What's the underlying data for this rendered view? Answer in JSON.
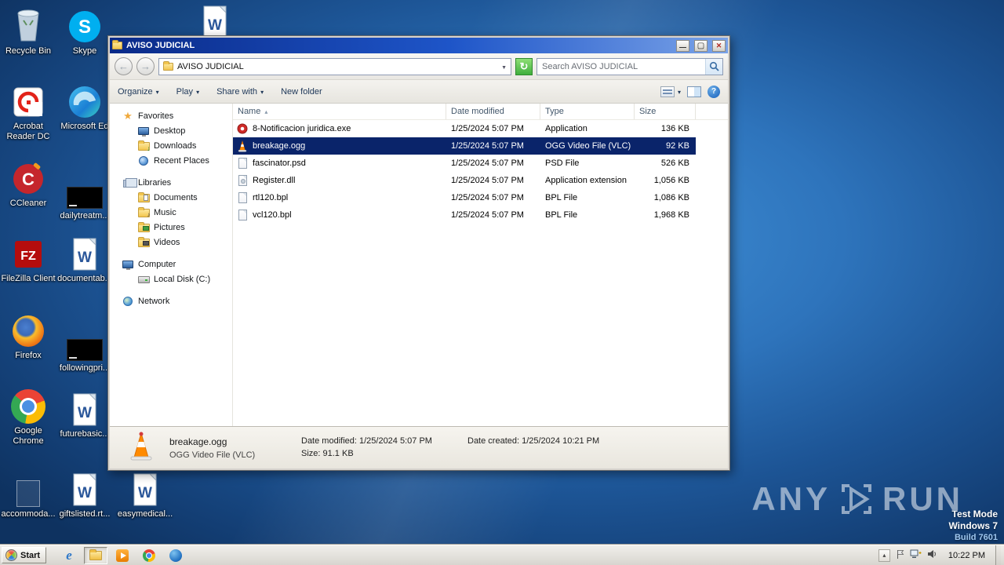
{
  "desktop": {
    "icons": [
      {
        "label": "Recycle Bin"
      },
      {
        "label": "Acrobat Reader DC"
      },
      {
        "label": "CCleaner"
      },
      {
        "label": "FileZilla Client"
      },
      {
        "label": "Firefox"
      },
      {
        "label": "Google Chrome"
      },
      {
        "label": "accommoda..."
      },
      {
        "label": "Skype"
      },
      {
        "label": "Microsoft Ed"
      },
      {
        "label": "dailytreatm..."
      },
      {
        "label": "documentab..."
      },
      {
        "label": "followingpri..."
      },
      {
        "label": "futurebasic..."
      },
      {
        "label": "giftslisted.rt..."
      },
      {
        "label": "easymedical..."
      }
    ]
  },
  "window": {
    "title": "AVISO JUDICIAL",
    "address": "AVISO JUDICIAL",
    "search_placeholder": "Search AVISO JUDICIAL",
    "toolbar": {
      "organize": "Organize",
      "play": "Play",
      "share_with": "Share with",
      "new_folder": "New folder"
    },
    "columns": {
      "name": "Name",
      "date_modified": "Date modified",
      "type": "Type",
      "size": "Size"
    },
    "files": [
      {
        "name": "8-Notificacion juridica.exe",
        "date": "1/25/2024 5:07 PM",
        "type": "Application",
        "size": "136 KB"
      },
      {
        "name": "breakage.ogg",
        "date": "1/25/2024 5:07 PM",
        "type": "OGG Video File (VLC)",
        "size": "92 KB"
      },
      {
        "name": "fascinator.psd",
        "date": "1/25/2024 5:07 PM",
        "type": "PSD File",
        "size": "526 KB"
      },
      {
        "name": "Register.dll",
        "date": "1/25/2024 5:07 PM",
        "type": "Application extension",
        "size": "1,056 KB"
      },
      {
        "name": "rtl120.bpl",
        "date": "1/25/2024 5:07 PM",
        "type": "BPL File",
        "size": "1,086 KB"
      },
      {
        "name": "vcl120.bpl",
        "date": "1/25/2024 5:07 PM",
        "type": "BPL File",
        "size": "1,968 KB"
      }
    ],
    "sidebar": {
      "favorites": {
        "label": "Favorites",
        "items": [
          "Desktop",
          "Downloads",
          "Recent Places"
        ]
      },
      "libraries": {
        "label": "Libraries",
        "items": [
          "Documents",
          "Music",
          "Pictures",
          "Videos"
        ]
      },
      "computer": {
        "label": "Computer",
        "items": [
          "Local Disk (C:)"
        ]
      },
      "network": {
        "label": "Network"
      }
    },
    "details": {
      "name": "breakage.ogg",
      "type": "OGG Video File (VLC)",
      "modified": "Date modified: 1/25/2024 5:07 PM",
      "size": "Size: 91.1 KB",
      "created": "Date created: 1/25/2024 10:21 PM"
    }
  },
  "taskbar": {
    "start_label": "Start",
    "clock": "10:22 PM"
  },
  "watermark": {
    "brand_left": "ANY",
    "brand_right": "RUN",
    "line1": "Test Mode",
    "line2": "Windows 7",
    "line3": "Build 7601"
  }
}
